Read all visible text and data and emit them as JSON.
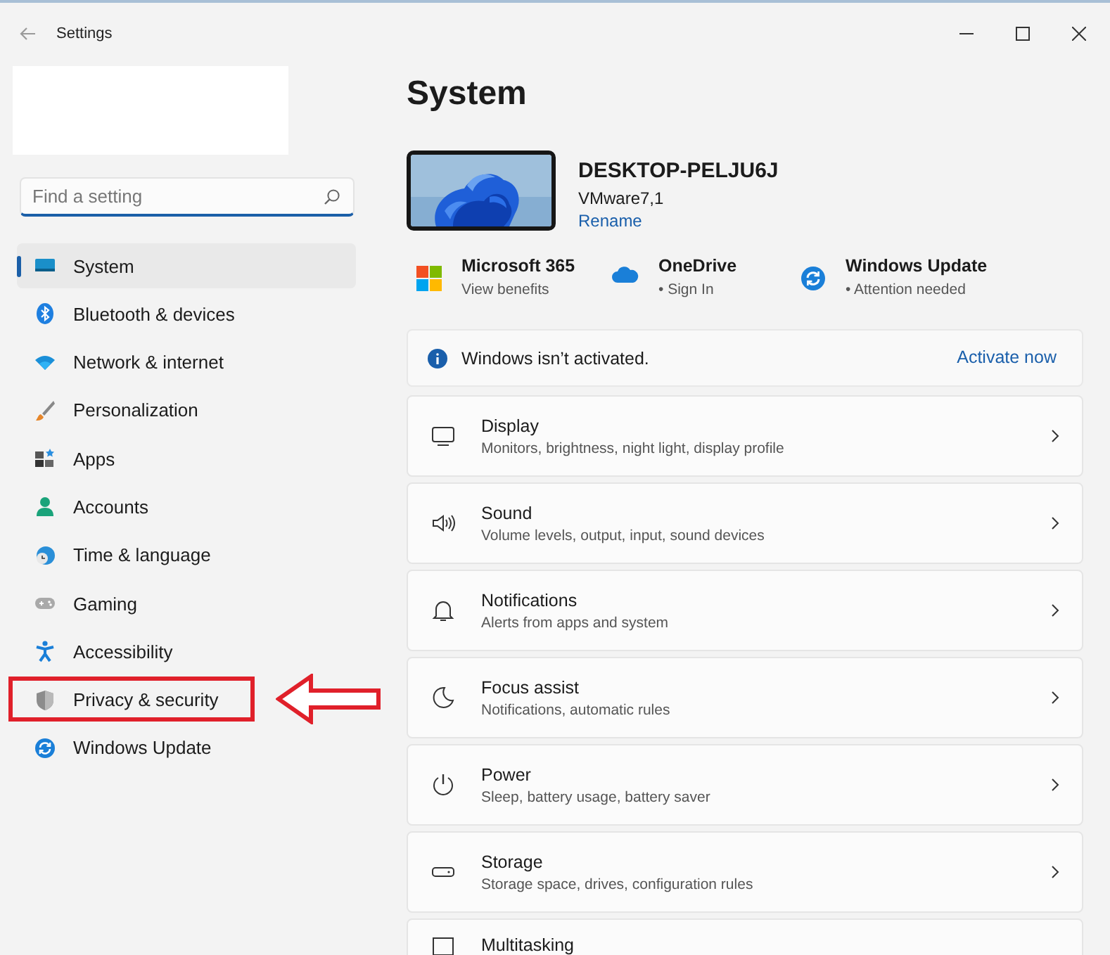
{
  "window": {
    "title": "Settings"
  },
  "search": {
    "placeholder": "Find a setting"
  },
  "sidebar": {
    "items": [
      {
        "label": "System",
        "selected": true,
        "highlighted": false
      },
      {
        "label": "Bluetooth & devices",
        "selected": false,
        "highlighted": false
      },
      {
        "label": "Network & internet",
        "selected": false,
        "highlighted": false
      },
      {
        "label": "Personalization",
        "selected": false,
        "highlighted": false
      },
      {
        "label": "Apps",
        "selected": false,
        "highlighted": false
      },
      {
        "label": "Accounts",
        "selected": false,
        "highlighted": false
      },
      {
        "label": "Time & language",
        "selected": false,
        "highlighted": false
      },
      {
        "label": "Gaming",
        "selected": false,
        "highlighted": false
      },
      {
        "label": "Accessibility",
        "selected": false,
        "highlighted": false
      },
      {
        "label": "Privacy & security",
        "selected": false,
        "highlighted": true
      },
      {
        "label": "Windows Update",
        "selected": false,
        "highlighted": false
      }
    ]
  },
  "page": {
    "title": "System"
  },
  "device": {
    "name": "DESKTOP-PELJU6J",
    "model": "VMware7,1",
    "link": "Rename"
  },
  "quick_links": [
    {
      "title": "Microsoft 365",
      "subtitle": "View benefits"
    },
    {
      "title": "OneDrive",
      "subtitle": "• Sign In"
    },
    {
      "title": "Windows Update",
      "subtitle": "• Attention needed"
    }
  ],
  "activation_banner": {
    "message": "Windows isn’t activated.",
    "action": "Activate now"
  },
  "settings": [
    {
      "title": "Display",
      "description": "Monitors, brightness, night light, display profile"
    },
    {
      "title": "Sound",
      "description": "Volume levels, output, input, sound devices"
    },
    {
      "title": "Notifications",
      "description": "Alerts from apps and system"
    },
    {
      "title": "Focus assist",
      "description": "Notifications, automatic rules"
    },
    {
      "title": "Power",
      "description": "Sleep, battery usage, battery saver"
    },
    {
      "title": "Storage",
      "description": "Storage space, drives, configuration rules"
    },
    {
      "title": "Multitasking"
    }
  ]
}
